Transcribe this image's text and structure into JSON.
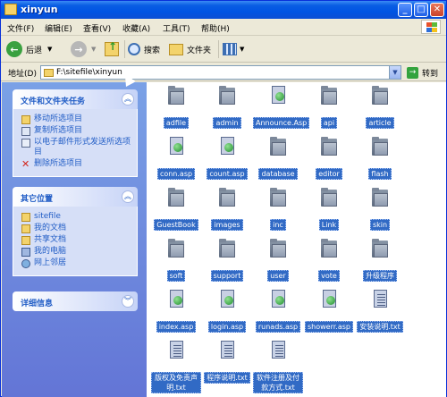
{
  "window": {
    "title": "xinyun"
  },
  "menu": [
    {
      "label": "文件(F)"
    },
    {
      "label": "编辑(E)"
    },
    {
      "label": "查看(V)"
    },
    {
      "label": "收藏(A)"
    },
    {
      "label": "工具(T)"
    },
    {
      "label": "帮助(H)"
    }
  ],
  "toolbar": {
    "back_label": "后退",
    "search_label": "搜索",
    "folders_label": "文件夹"
  },
  "address": {
    "label": "地址(D)",
    "value": "F:\\sitefile\\xinyun",
    "go_label": "转到"
  },
  "tasks_panel": {
    "title": "文件和文件夹任务",
    "items": [
      {
        "label": "移动所选项目",
        "icon": "move-icon"
      },
      {
        "label": "复制所选项目",
        "icon": "copy-icon"
      },
      {
        "label": "以电子邮件形式发送所选项目",
        "icon": "email-icon"
      },
      {
        "label": "删除所选项目",
        "icon": "delete-icon"
      }
    ]
  },
  "places_panel": {
    "title": "其它位置",
    "items": [
      {
        "label": "sitefile",
        "icon": "folder-icon"
      },
      {
        "label": "我的文档",
        "icon": "my-documents-icon"
      },
      {
        "label": "共享文档",
        "icon": "shared-documents-icon"
      },
      {
        "label": "我的电脑",
        "icon": "my-computer-icon"
      },
      {
        "label": "网上邻居",
        "icon": "network-icon"
      }
    ]
  },
  "details_panel": {
    "title": "详细信息"
  },
  "files": [
    {
      "name": "adfile",
      "type": "folder"
    },
    {
      "name": "admin",
      "type": "folder"
    },
    {
      "name": "Announce.Asp",
      "type": "asp"
    },
    {
      "name": "api",
      "type": "folder"
    },
    {
      "name": "article",
      "type": "folder"
    },
    {
      "name": "conn.asp",
      "type": "asp"
    },
    {
      "name": "count.asp",
      "type": "asp"
    },
    {
      "name": "database",
      "type": "folder"
    },
    {
      "name": "editor",
      "type": "folder"
    },
    {
      "name": "flash",
      "type": "folder"
    },
    {
      "name": "GuestBook",
      "type": "folder"
    },
    {
      "name": "images",
      "type": "folder"
    },
    {
      "name": "inc",
      "type": "folder"
    },
    {
      "name": "Link",
      "type": "folder"
    },
    {
      "name": "skin",
      "type": "folder"
    },
    {
      "name": "soft",
      "type": "folder"
    },
    {
      "name": "support",
      "type": "folder"
    },
    {
      "name": "user",
      "type": "folder"
    },
    {
      "name": "vote",
      "type": "folder"
    },
    {
      "name": "升级程序",
      "type": "folder"
    },
    {
      "name": "index.asp",
      "type": "asp"
    },
    {
      "name": "login.asp",
      "type": "asp"
    },
    {
      "name": "runads.asp",
      "type": "asp"
    },
    {
      "name": "showerr.asp",
      "type": "asp"
    },
    {
      "name": "安装说明.txt",
      "type": "txt"
    },
    {
      "name": "版权及免责声明.txt",
      "type": "txt"
    },
    {
      "name": "程序说明.txt",
      "type": "txt"
    },
    {
      "name": "软件注册及付款方式.txt",
      "type": "txt"
    }
  ]
}
